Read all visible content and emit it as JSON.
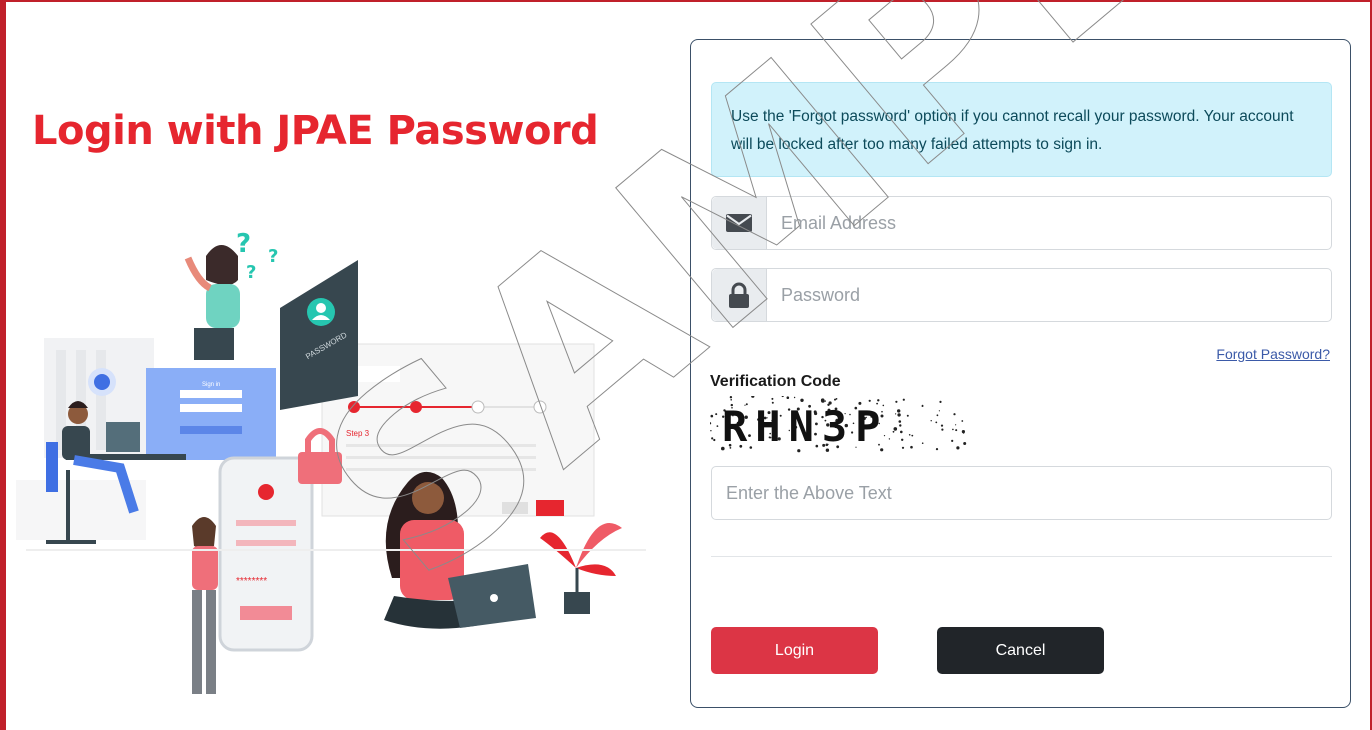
{
  "page": {
    "heading": "Login with JPAE Password",
    "brand_color": "#e6262f",
    "frame_color": "#c0202a"
  },
  "alert": {
    "text": "Use the 'Forgot password' option if you cannot recall your password. Your account will be locked after too many failed attempts to sign in."
  },
  "form": {
    "email_placeholder": "Email Address",
    "email_icon": "envelope-icon",
    "password_placeholder": "Password",
    "password_icon": "lock-icon",
    "forgot_link": "Forgot Password?",
    "verification_label": "Verification Code",
    "captcha_text": "RHN3P",
    "captcha_placeholder": "Enter the Above Text",
    "login_label": "Login",
    "cancel_label": "Cancel"
  },
  "illustration": {
    "monitor_text": "PASSWORD",
    "signin_title": "Sign in",
    "step_label": "Step 3"
  },
  "watermark": "SAMPLE",
  "colors": {
    "login_button": "#dc3545",
    "cancel_button": "#212529",
    "alert_bg": "#d1f2fb",
    "link": "#3b5aa8"
  }
}
